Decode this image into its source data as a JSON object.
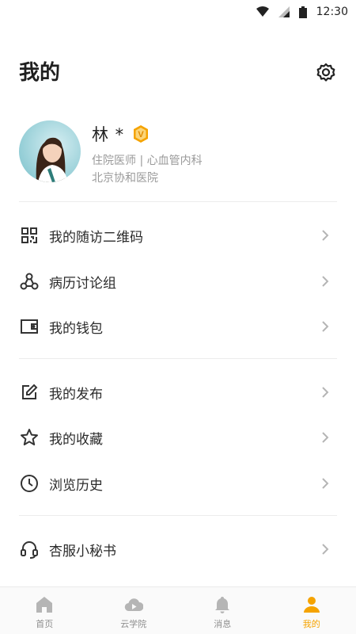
{
  "status_bar": {
    "time": "12:30"
  },
  "header": {
    "title": "我的"
  },
  "profile": {
    "name": "林 *",
    "title": "住院医师 | 心血管内科",
    "hospital": "北京协和医院",
    "badge_letter": "V"
  },
  "menu_groups": [
    {
      "items": [
        {
          "label": "我的随访二维码",
          "icon": "qr-code-icon"
        },
        {
          "label": "病历讨论组",
          "icon": "group-nodes-icon"
        },
        {
          "label": "我的钱包",
          "icon": "wallet-icon"
        }
      ]
    },
    {
      "items": [
        {
          "label": "我的发布",
          "icon": "edit-icon"
        },
        {
          "label": "我的收藏",
          "icon": "star-icon"
        },
        {
          "label": "浏览历史",
          "icon": "clock-icon"
        }
      ]
    },
    {
      "items": [
        {
          "label": "杏服小秘书",
          "icon": "headset-icon"
        }
      ]
    }
  ],
  "tabbar": {
    "active_index": 3,
    "tabs": [
      {
        "label": "首页",
        "icon": "home-icon"
      },
      {
        "label": "云学院",
        "icon": "cloud-play-icon"
      },
      {
        "label": "消息",
        "icon": "bell-icon"
      },
      {
        "label": "我的",
        "icon": "person-icon"
      }
    ]
  },
  "colors": {
    "accent": "#f5a300",
    "icon": "#333333",
    "secondary_text": "#9a9a9a",
    "divider": "#ececec",
    "tab_inactive": "#b5b5b5"
  }
}
